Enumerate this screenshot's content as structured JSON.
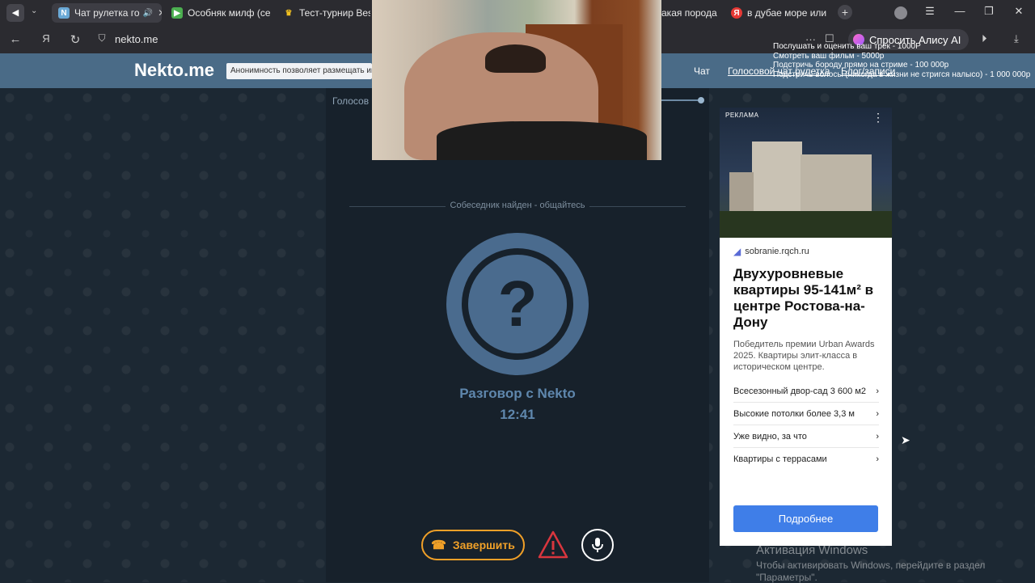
{
  "browser": {
    "tabs": [
      {
        "title": "Чат рулетка го",
        "active": true
      },
      {
        "title": "Особняк милф (сер",
        "active": false
      },
      {
        "title": "Тест-турнир Best",
        "active": false
      },
      {
        "title": "акая порода с",
        "active": false
      },
      {
        "title": "в дубае море или о",
        "active": false
      }
    ],
    "url": "nekto.me",
    "alice_label": "Спросить Алису AI"
  },
  "stream_overlay": [
    "Послушать и оценить ваш трек - 1000Р",
    "Смотреть ваш фильм - 5000р",
    "Подстричь бороду прямо на стриме - 100 000р",
    "Подстричь волосы (никогда в жизни не стригся налысо) - 1 000 000р"
  ],
  "site": {
    "logo": "Nekto.me",
    "banner_text": "Анонимность позволяет размещать инф",
    "nav": [
      "Чат",
      "Голосовой чат рулетка",
      "Блог/записи"
    ]
  },
  "chat": {
    "title_partial": "Голосов",
    "status_divider": "Собеседник найден - общайтесь",
    "conversation_label": "Разговор с Nekto",
    "timer": "12:41",
    "end_button": "Завершить"
  },
  "ad": {
    "label": "РЕКЛАМА",
    "site": "sobranie.rqch.ru",
    "headline": "Двухуровневые квартиры 95-141м² в центре Ростова-на-Дону",
    "description": "Победитель премии Urban Awards 2025. Квартиры элит-класса в историческом центре.",
    "features": [
      "Всесезонный двор-сад 3 600 м2",
      "Высокие потолки более 3,3 м",
      "Уже видно, за что",
      "Квартиры с террасами"
    ],
    "cta": "Подробнее"
  },
  "windows_activation": {
    "title": "Активация Windows",
    "line1": "Чтобы активировать Windows, перейдите в раздел",
    "line2": "\"Параметры\"."
  },
  "colors": {
    "accent_orange": "#f0a028",
    "site_header": "#4a6b87",
    "cta_blue": "#3f7ee8"
  }
}
